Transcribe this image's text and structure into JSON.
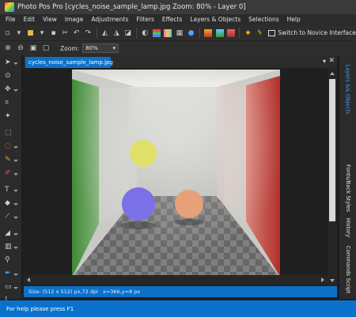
{
  "window": {
    "title": "Photo Pos Pro [cycles_noise_sample_lamp.jpg Zoom: 80% - Layer 0]"
  },
  "menu": [
    "File",
    "Edit",
    "View",
    "Image",
    "Adjustments",
    "Filters",
    "Effects",
    "Layers & Objects",
    "Selections",
    "Help"
  ],
  "toolbar": {
    "novice_label": "Switch to Novice Interface",
    "zoom_label": "Zoom:",
    "zoom_value": "80%"
  },
  "document": {
    "tab_label": "cycles_noise_sample_lamp.jpg",
    "tab_menu_icon": "triangle-down",
    "tab_close_icon": "close-x"
  },
  "info": {
    "size": "Size: (512 x 512) px,72 dpi",
    "position": "x=366,y=8 px"
  },
  "right_tabs": [
    "Layers && Objects",
    "Fonts/Back Styles",
    "History",
    "Commands Script"
  ],
  "status": {
    "text": "For help please press F1"
  },
  "colors": {
    "accent": "#0d71c9",
    "status_bar": "#0a72cc",
    "wall_left": "#4f9a45",
    "wall_right": "#c03c36",
    "sphere_yellow": "#e0df6a",
    "sphere_blue": "#7b70e8",
    "sphere_orange": "#e7a178"
  }
}
